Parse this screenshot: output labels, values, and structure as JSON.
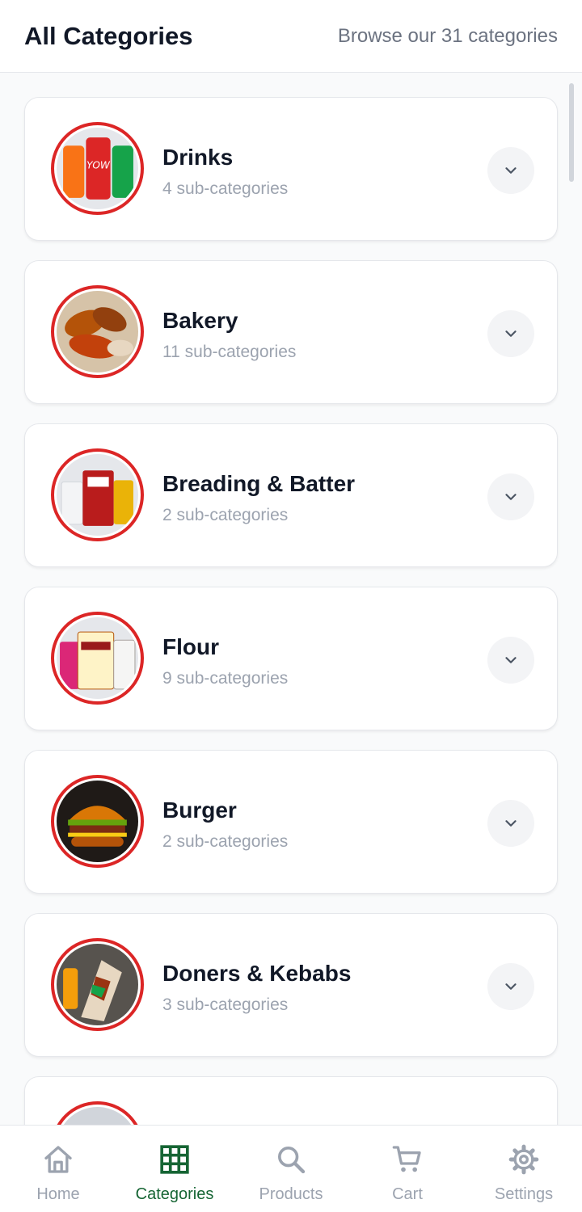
{
  "header": {
    "title": "All Categories",
    "subtitle": "Browse our 31 categories"
  },
  "categories": [
    {
      "name": "Drinks",
      "subcount": "4 sub-categories",
      "image": "drinks-image"
    },
    {
      "name": "Bakery",
      "subcount": "11 sub-categories",
      "image": "bakery-image"
    },
    {
      "name": "Breading & Batter",
      "subcount": "2 sub-categories",
      "image": "breading-image"
    },
    {
      "name": "Flour",
      "subcount": "9 sub-categories",
      "image": "flour-image"
    },
    {
      "name": "Burger",
      "subcount": "2 sub-categories",
      "image": "burger-image"
    },
    {
      "name": "Doners & Kebabs",
      "subcount": "3 sub-categories",
      "image": "doner-image"
    }
  ],
  "nav": {
    "items": [
      {
        "label": "Home",
        "icon": "home-icon"
      },
      {
        "label": "Categories",
        "icon": "grid-icon"
      },
      {
        "label": "Products",
        "icon": "search-icon"
      },
      {
        "label": "Cart",
        "icon": "cart-icon"
      },
      {
        "label": "Settings",
        "icon": "gear-icon"
      }
    ],
    "active_index": 1
  },
  "colors": {
    "accent": "#166534",
    "thumb_ring": "#dc2626",
    "muted": "#9ca3af"
  }
}
